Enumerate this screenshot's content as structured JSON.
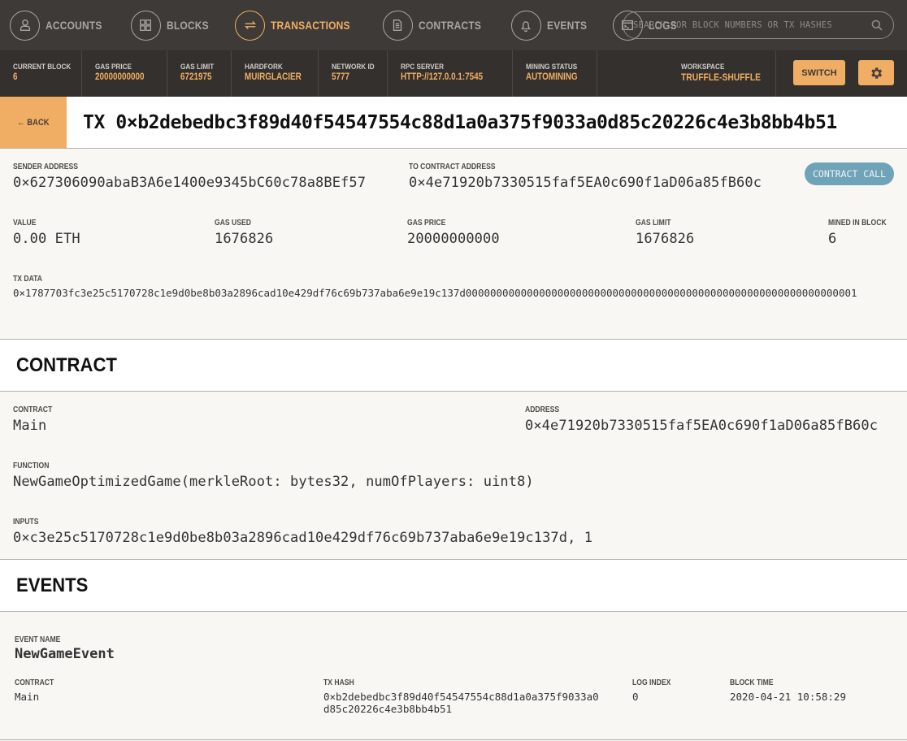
{
  "nav": {
    "items": [
      {
        "label": "ACCOUNTS",
        "icon": "person-icon",
        "active": false
      },
      {
        "label": "BLOCKS",
        "icon": "grid-icon",
        "active": false
      },
      {
        "label": "TRANSACTIONS",
        "icon": "swap-arrows-icon",
        "active": true
      },
      {
        "label": "CONTRACTS",
        "icon": "document-icon",
        "active": false
      },
      {
        "label": "EVENTS",
        "icon": "bell-icon",
        "active": false
      },
      {
        "label": "LOGS",
        "icon": "terminal-icon",
        "active": false
      }
    ],
    "search_placeholder": "SEARCH FOR BLOCK NUMBERS OR TX HASHES"
  },
  "stats": {
    "current_block": {
      "label": "CURRENT BLOCK",
      "value": "6"
    },
    "gas_price": {
      "label": "GAS PRICE",
      "value": "20000000000"
    },
    "gas_limit": {
      "label": "GAS LIMIT",
      "value": "6721975"
    },
    "hardfork": {
      "label": "HARDFORK",
      "value": "MUIRGLACIER"
    },
    "network_id": {
      "label": "NETWORK ID",
      "value": "5777"
    },
    "rpc_server": {
      "label": "RPC SERVER",
      "value": "HTTP://127.0.0.1:7545"
    },
    "mining_status": {
      "label": "MINING STATUS",
      "value": "AUTOMINING"
    },
    "workspace": {
      "label": "WORKSPACE",
      "value": "TRUFFLE-SHUFFLE"
    },
    "switch_label": "SWITCH"
  },
  "tx": {
    "back_label": "← BACK",
    "title": "TX 0×b2debedbc3f89d40f54547554c88d1a0a375f9033a0d85c20226c4e3b8bb4b51",
    "sender": {
      "label": "SENDER ADDRESS",
      "value": "0×627306090abaB3A6e1400e9345bC60c78a8BEf57"
    },
    "to": {
      "label": "TO CONTRACT ADDRESS",
      "value": "0×4e71920b7330515faf5EA0c690f1aD06a85fB60c"
    },
    "badge": "CONTRACT CALL",
    "value": {
      "label": "VALUE",
      "value": "0.00 ETH"
    },
    "gas_used": {
      "label": "GAS USED",
      "value": "1676826"
    },
    "gas_price": {
      "label": "GAS PRICE",
      "value": "20000000000"
    },
    "gas_limit": {
      "label": "GAS LIMIT",
      "value": "1676826"
    },
    "mined_in_block": {
      "label": "MINED IN BLOCK",
      "value": "6"
    },
    "tx_data": {
      "label": "TX DATA",
      "value": "0×1787703fc3e25c5170728c1e9d0be8b03a2896cad10e429df76c69b737aba6e9e19c137d0000000000000000000000000000000000000000000000000000000000000001"
    }
  },
  "contract": {
    "heading": "CONTRACT",
    "name": {
      "label": "CONTRACT",
      "value": "Main"
    },
    "address": {
      "label": "ADDRESS",
      "value": "0×4e71920b7330515faf5EA0c690f1aD06a85fB60c"
    },
    "function": {
      "label": "FUNCTION",
      "value": "NewGameOptimizedGame(merkleRoot: bytes32, numOfPlayers: uint8)"
    },
    "inputs": {
      "label": "INPUTS",
      "value": "0×c3e25c5170728c1e9d0be8b03a2896cad10e429df76c69b737aba6e9e19c137d, 1"
    }
  },
  "events": {
    "heading": "EVENTS",
    "items": [
      {
        "event_name": {
          "label": "EVENT NAME",
          "value": "NewGameEvent"
        },
        "contract": {
          "label": "CONTRACT",
          "value": "Main"
        },
        "tx_hash": {
          "label": "TX HASH",
          "value": "0×b2debedbc3f89d40f54547554c88d1a0a375f9033a0d85c20226c4e3b8bb4b51"
        },
        "log_index": {
          "label": "LOG INDEX",
          "value": "0"
        },
        "block_time": {
          "label": "BLOCK TIME",
          "value": "2020-04-21 10:58:29"
        }
      }
    ]
  },
  "colors": {
    "accent": "#f0ae64",
    "nav_bg": "#3d3a37",
    "stats_bg": "#33302d",
    "badge": "#6fa3b8"
  }
}
